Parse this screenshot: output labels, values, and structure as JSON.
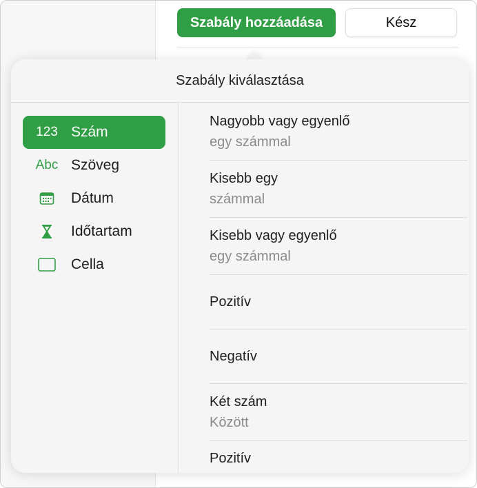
{
  "toolbar": {
    "add_rule_label": "Szabály hozzáadása",
    "done_label": "Kész"
  },
  "popover": {
    "title": "Szabály kiválasztása"
  },
  "categories": [
    {
      "icon_text": "123",
      "label": "Szám",
      "icon": "number-icon",
      "selected": true
    },
    {
      "icon_text": "Abc",
      "label": "Szöveg",
      "icon": "text-icon",
      "selected": false
    },
    {
      "icon_text": "",
      "label": "Dátum",
      "icon": "calendar-icon",
      "selected": false
    },
    {
      "icon_text": "",
      "label": "Időtartam",
      "icon": "hourglass-icon",
      "selected": false
    },
    {
      "icon_text": "",
      "label": "Cella",
      "icon": "cell-icon",
      "selected": false
    }
  ],
  "rules": [
    {
      "title": "Nagyobb vagy egyenlő",
      "subtitle": "egy számmal"
    },
    {
      "title": "Kisebb egy",
      "subtitle": "számmal"
    },
    {
      "title": "Kisebb vagy egyenlő",
      "subtitle": "egy számmal"
    },
    {
      "title": "Pozitív",
      "subtitle": ""
    },
    {
      "title": "Negatív",
      "subtitle": ""
    },
    {
      "title": "Két szám",
      "subtitle": "Között"
    },
    {
      "title": "Pozitív",
      "subtitle": ""
    }
  ],
  "colors": {
    "accent": "#2f9e44"
  }
}
